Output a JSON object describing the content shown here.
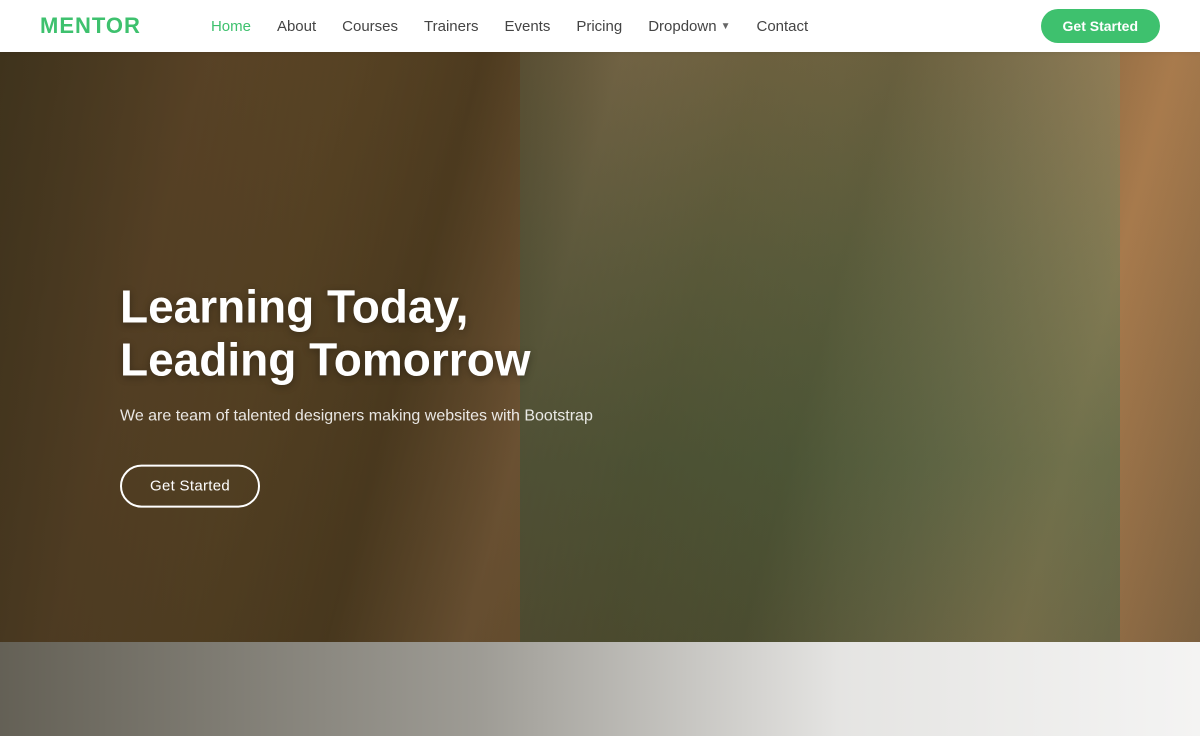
{
  "brand": {
    "name": "MENTOR"
  },
  "navbar": {
    "links": [
      {
        "label": "Home",
        "active": true
      },
      {
        "label": "About",
        "active": false
      },
      {
        "label": "Courses",
        "active": false
      },
      {
        "label": "Trainers",
        "active": false
      },
      {
        "label": "Events",
        "active": false
      },
      {
        "label": "Pricing",
        "active": false
      },
      {
        "label": "Dropdown",
        "hasDropdown": true,
        "active": false
      },
      {
        "label": "Contact",
        "active": false
      }
    ],
    "cta_label": "Get Started"
  },
  "hero": {
    "title_line1": "Learning Today,",
    "title_line2": "Leading Tomorrow",
    "subtitle": "We are team of talented designers making websites with Bootstrap",
    "cta_label": "Get Started"
  },
  "colors": {
    "brand_green": "#3ec16e",
    "hero_overlay": "rgba(40,35,20,0.65)"
  }
}
